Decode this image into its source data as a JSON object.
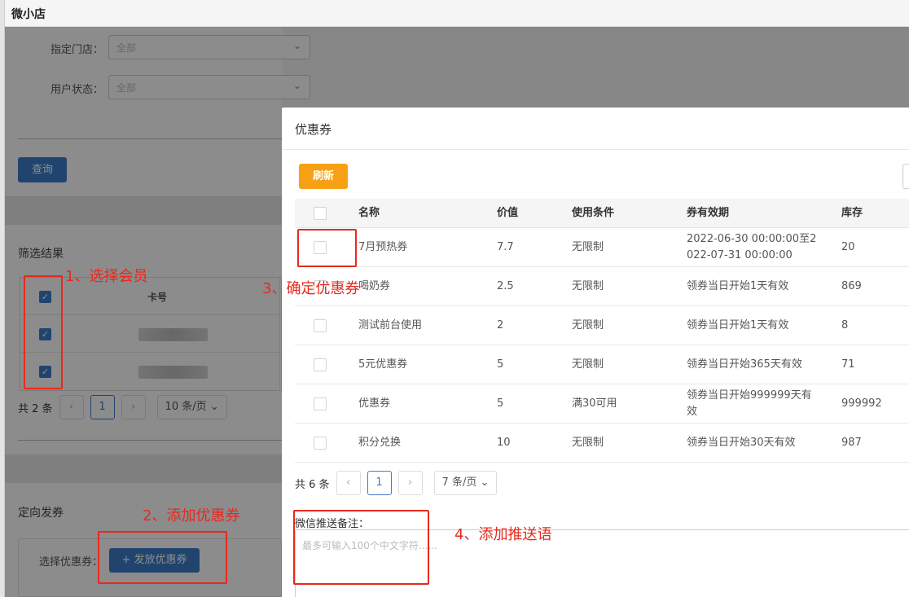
{
  "app_title": "微小店",
  "filters": {
    "store_label": "指定门店：",
    "store_value": "全部",
    "status_label": "用户状态：",
    "status_value": "全部",
    "query_button": "查询"
  },
  "results": {
    "title": "筛选结果",
    "column_card": "卡号",
    "rows": [
      {
        "checked": true
      },
      {
        "checked": true
      }
    ],
    "total": "共 2 条",
    "page": "1",
    "page_size": "10 条/页",
    "prev": "‹",
    "next": "›"
  },
  "targeted": {
    "title": "定向发券",
    "select_label": "选择优惠券：",
    "issue_button": "+ 发放优惠券"
  },
  "modal": {
    "title": "优惠券",
    "refresh_button": "刷新",
    "columns": [
      "名称",
      "价值",
      "使用条件",
      "券有效期",
      "库存"
    ],
    "rows": [
      {
        "name": "7月预热券",
        "value": "7.7",
        "condition": "无限制",
        "validity": "2022-06-30 00:00:00至2022-07-31 00:00:00",
        "stock": "20"
      },
      {
        "name": "喝奶券",
        "value": "2.5",
        "condition": "无限制",
        "validity": "领券当日开始1天有效",
        "stock": "869"
      },
      {
        "name": "测试前台使用",
        "value": "2",
        "condition": "无限制",
        "validity": "领券当日开始1天有效",
        "stock": "8"
      },
      {
        "name": "5元优惠券",
        "value": "5",
        "condition": "无限制",
        "validity": "领券当日开始365天有效",
        "stock": "71"
      },
      {
        "name": "优惠券",
        "value": "5",
        "condition": "满30可用",
        "validity": "领券当日开始999999天有效",
        "stock": "999992"
      },
      {
        "name": "积分兑换",
        "value": "10",
        "condition": "无限制",
        "validity": "领券当日开始30天有效",
        "stock": "987"
      }
    ],
    "total": "共 6 条",
    "page": "1",
    "page_size": "7 条/页",
    "prev": "‹",
    "next": "›",
    "remark_label": "微信推送备注：",
    "remark_placeholder": "最多可输入100个中文字符......"
  },
  "annotations": {
    "step1": "1、选择会员",
    "step2": "2、添加优惠券",
    "step3": "3、确定优惠券",
    "step4": "4、添加推送语"
  },
  "colors": {
    "primary": "#3d7dca",
    "orange": "#f7a014",
    "annotation_red": "#e8291e"
  }
}
